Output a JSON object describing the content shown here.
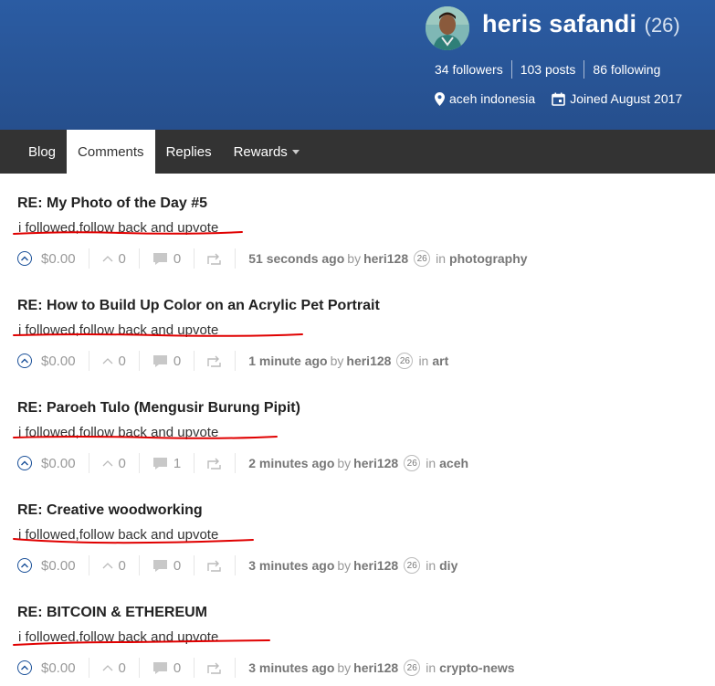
{
  "profile": {
    "name": "heris safandi",
    "reputation": "(26)",
    "followers": "34 followers",
    "posts": "103 posts",
    "following": "86 following",
    "location": "aceh indonesia",
    "joined": "Joined August 2017"
  },
  "tabs": [
    {
      "label": "Blog"
    },
    {
      "label": "Comments"
    },
    {
      "label": "Replies"
    },
    {
      "label": "Rewards"
    }
  ],
  "comments": [
    {
      "title": "RE: My Photo of the Day #5",
      "body": "i followed,follow back and upvote",
      "payout": "$0.00",
      "votes": "0",
      "replies": "0",
      "ago": "51 seconds ago",
      "by": "by",
      "author": "heri128",
      "author_rep": "26",
      "in": "in",
      "category": "photography"
    },
    {
      "title": "RE: How to Build Up Color on an Acrylic Pet Portrait",
      "body": "i followed,follow back and upvote",
      "payout": "$0.00",
      "votes": "0",
      "replies": "0",
      "ago": "1 minute ago",
      "by": "by",
      "author": "heri128",
      "author_rep": "26",
      "in": "in",
      "category": "art"
    },
    {
      "title": "RE: Paroeh Tulo (Mengusir Burung Pipit)",
      "body": "i followed,follow back and upvote",
      "payout": "$0.00",
      "votes": "0",
      "replies": "1",
      "ago": "2 minutes ago",
      "by": "by",
      "author": "heri128",
      "author_rep": "26",
      "in": "in",
      "category": "aceh"
    },
    {
      "title": "RE: Creative woodworking",
      "body": "i followed,follow back and upvote",
      "payout": "$0.00",
      "votes": "0",
      "replies": "0",
      "ago": "3 minutes ago",
      "by": "by",
      "author": "heri128",
      "author_rep": "26",
      "in": "in",
      "category": "diy"
    },
    {
      "title": "RE: BITCOIN & ETHEREUM",
      "body": "i followed,follow back and upvote",
      "payout": "$0.00",
      "votes": "0",
      "replies": "0",
      "ago": "3 minutes ago",
      "by": "by",
      "author": "heri128",
      "author_rep": "26",
      "in": "in",
      "category": "crypto-news"
    }
  ],
  "colors": {
    "header": "#2b5ca3",
    "nav": "#333333",
    "upvote": "#1a5099",
    "annotation": "#e00000"
  },
  "icons": [
    "upvote-circle-icon",
    "downvote-chevron-icon",
    "comment-bubble-icon",
    "reblog-icon",
    "location-pin-icon",
    "calendar-icon",
    "dropdown-caret-icon"
  ]
}
